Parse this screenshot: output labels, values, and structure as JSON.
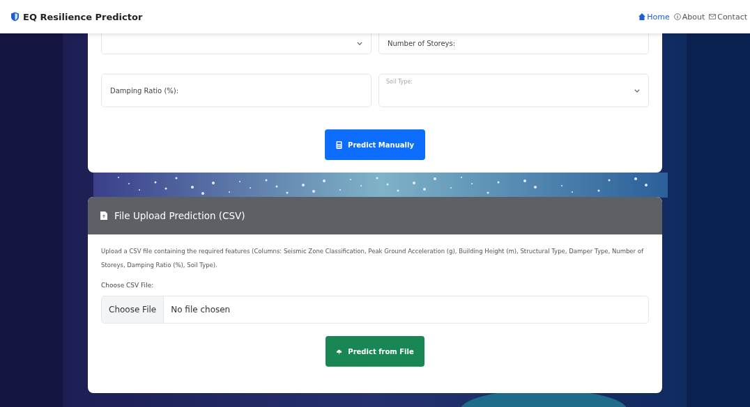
{
  "navbar": {
    "brand": "EQ Resilience Predictor",
    "links": [
      {
        "label": "Home",
        "selected": true
      },
      {
        "label": "About",
        "selected": false
      },
      {
        "label": "Contact",
        "selected": false
      }
    ]
  },
  "manual_form": {
    "fields": [
      {
        "kind": "select"
      },
      {
        "kind": "input",
        "placeholder": "Number of Storeys:"
      },
      {
        "kind": "input",
        "placeholder": "Damping Ratio (%):"
      },
      {
        "kind": "select",
        "placeholder": "Soil Type:"
      }
    ],
    "button": "Predict Manually"
  },
  "file_upload": {
    "title": "File Upload Prediction (CSV)",
    "description": "Upload a CSV file containing the required features (Columns: Seismic Zone Classification, Peak Ground Acceleration (g), Building Height (m), Structural Type, Damper Type, Number of Storeys, Damping Ratio (%), Soil Type).",
    "file_label": "Choose CSV File:",
    "choose_button": "Choose File",
    "file_status": "No file chosen",
    "button": "Predict from File"
  }
}
